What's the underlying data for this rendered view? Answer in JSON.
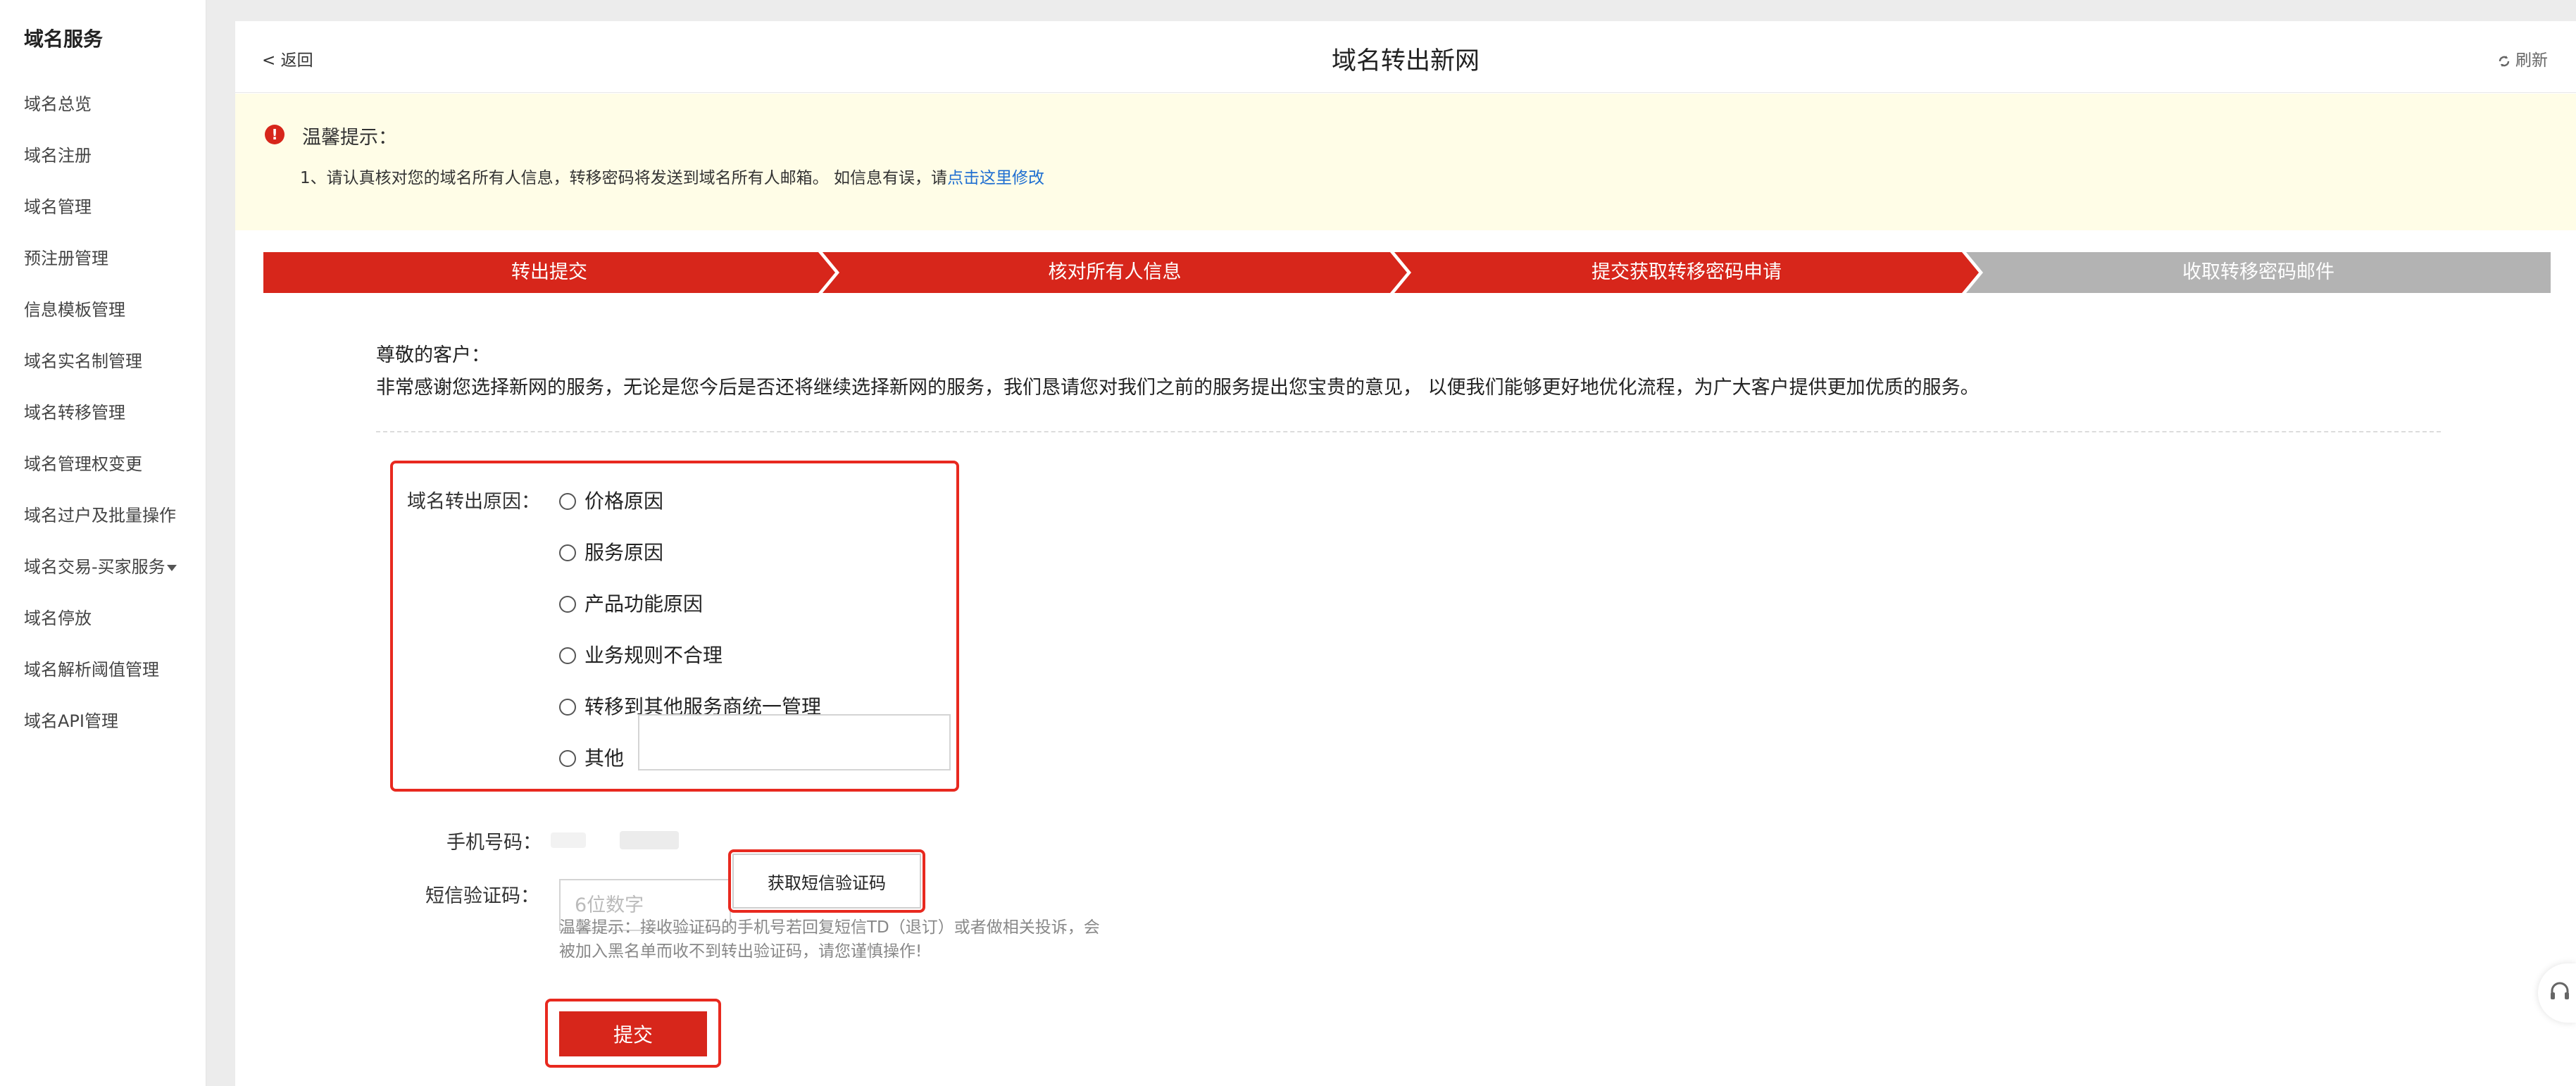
{
  "sidebar": {
    "title": "域名服务",
    "items": [
      {
        "label": "域名总览"
      },
      {
        "label": "域名注册"
      },
      {
        "label": "域名管理"
      },
      {
        "label": "预注册管理"
      },
      {
        "label": "信息模板管理"
      },
      {
        "label": "域名实名制管理"
      },
      {
        "label": "域名转移管理"
      },
      {
        "label": "域名管理权变更"
      },
      {
        "label": "域名过户及批量操作"
      },
      {
        "label": "域名交易-买家服务"
      },
      {
        "label": "域名停放"
      },
      {
        "label": "域名解析阈值管理"
      },
      {
        "label": "域名API管理"
      }
    ]
  },
  "header": {
    "back_label": "< 返回",
    "title": "域名转出新网",
    "refresh_label": "刷新"
  },
  "notice": {
    "title": "温馨提示：",
    "text": "1、请认真核对您的域名所有人信息，转移密码将发送到域名所有人邮箱。 如信息有误，请",
    "link": "点击这里修改"
  },
  "steps": [
    {
      "label": "转出提交",
      "status": "done"
    },
    {
      "label": "核对所有人信息",
      "status": "done"
    },
    {
      "label": "提交获取转移密码申请",
      "status": "done"
    },
    {
      "label": "收取转移密码邮件",
      "status": "todo"
    }
  ],
  "greeting": {
    "salutation": "尊敬的客户：",
    "message": "非常感谢您选择新网的服务，无论是您今后是否还将继续选择新网的服务，我们恳请您对我们之前的服务提出您宝贵的意见， 以便我们能够更好地优化流程，为广大客户提供更加优质的服务。"
  },
  "form": {
    "reason_label": "域名转出原因：",
    "reasons": [
      {
        "label": "价格原因"
      },
      {
        "label": "服务原因"
      },
      {
        "label": "产品功能原因"
      },
      {
        "label": "业务规则不合理"
      },
      {
        "label": "转移到其他服务商统一管理"
      },
      {
        "label": "其他"
      }
    ],
    "other_value": "",
    "phone_label": "手机号码：",
    "sms_label": "短信验证码：",
    "sms_placeholder": "6位数字",
    "sms_value": "",
    "get_code_label": "获取短信验证码",
    "tip_line1": "温馨提示：接收验证码的手机号若回复短信TD（退订）或者做相关投诉，会",
    "tip_line2": "被加入黑名单而收不到转出验证码，请您谨慎操作!",
    "submit_label": "提交"
  },
  "icons": {
    "notice": "exclamation-circle-icon",
    "refresh": "refresh-icon",
    "support": "headset-icon"
  },
  "colors": {
    "accent": "#d7261b",
    "step_todo": "#b3b3b3",
    "link": "#1f6fd1",
    "notice_bg": "#fffde7",
    "highlight": "#e8291f"
  }
}
